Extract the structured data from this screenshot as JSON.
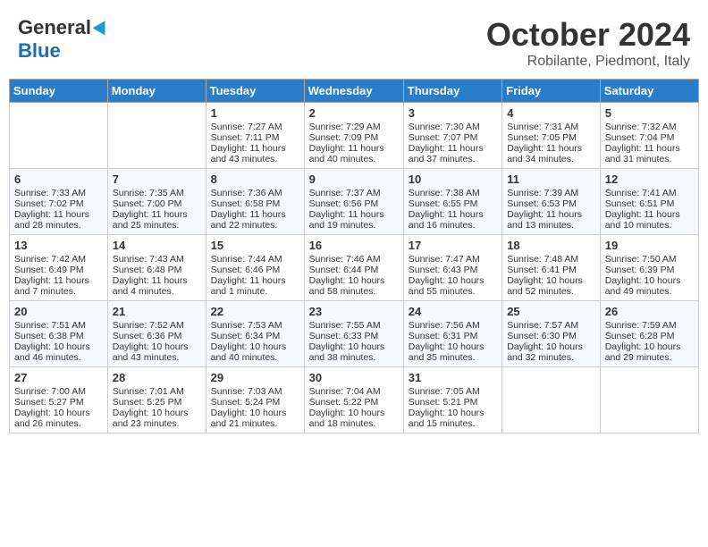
{
  "logo": {
    "general": "General",
    "blue": "Blue"
  },
  "title": "October 2024",
  "location": "Robilante, Piedmont, Italy",
  "days_of_week": [
    "Sunday",
    "Monday",
    "Tuesday",
    "Wednesday",
    "Thursday",
    "Friday",
    "Saturday"
  ],
  "weeks": [
    [
      {
        "day": "",
        "content": ""
      },
      {
        "day": "",
        "content": ""
      },
      {
        "day": "1",
        "content": "Sunrise: 7:27 AM\nSunset: 7:11 PM\nDaylight: 11 hours and 43 minutes."
      },
      {
        "day": "2",
        "content": "Sunrise: 7:29 AM\nSunset: 7:09 PM\nDaylight: 11 hours and 40 minutes."
      },
      {
        "day": "3",
        "content": "Sunrise: 7:30 AM\nSunset: 7:07 PM\nDaylight: 11 hours and 37 minutes."
      },
      {
        "day": "4",
        "content": "Sunrise: 7:31 AM\nSunset: 7:05 PM\nDaylight: 11 hours and 34 minutes."
      },
      {
        "day": "5",
        "content": "Sunrise: 7:32 AM\nSunset: 7:04 PM\nDaylight: 11 hours and 31 minutes."
      }
    ],
    [
      {
        "day": "6",
        "content": "Sunrise: 7:33 AM\nSunset: 7:02 PM\nDaylight: 11 hours and 28 minutes."
      },
      {
        "day": "7",
        "content": "Sunrise: 7:35 AM\nSunset: 7:00 PM\nDaylight: 11 hours and 25 minutes."
      },
      {
        "day": "8",
        "content": "Sunrise: 7:36 AM\nSunset: 6:58 PM\nDaylight: 11 hours and 22 minutes."
      },
      {
        "day": "9",
        "content": "Sunrise: 7:37 AM\nSunset: 6:56 PM\nDaylight: 11 hours and 19 minutes."
      },
      {
        "day": "10",
        "content": "Sunrise: 7:38 AM\nSunset: 6:55 PM\nDaylight: 11 hours and 16 minutes."
      },
      {
        "day": "11",
        "content": "Sunrise: 7:39 AM\nSunset: 6:53 PM\nDaylight: 11 hours and 13 minutes."
      },
      {
        "day": "12",
        "content": "Sunrise: 7:41 AM\nSunset: 6:51 PM\nDaylight: 11 hours and 10 minutes."
      }
    ],
    [
      {
        "day": "13",
        "content": "Sunrise: 7:42 AM\nSunset: 6:49 PM\nDaylight: 11 hours and 7 minutes."
      },
      {
        "day": "14",
        "content": "Sunrise: 7:43 AM\nSunset: 6:48 PM\nDaylight: 11 hours and 4 minutes."
      },
      {
        "day": "15",
        "content": "Sunrise: 7:44 AM\nSunset: 6:46 PM\nDaylight: 11 hours and 1 minute."
      },
      {
        "day": "16",
        "content": "Sunrise: 7:46 AM\nSunset: 6:44 PM\nDaylight: 10 hours and 58 minutes."
      },
      {
        "day": "17",
        "content": "Sunrise: 7:47 AM\nSunset: 6:43 PM\nDaylight: 10 hours and 55 minutes."
      },
      {
        "day": "18",
        "content": "Sunrise: 7:48 AM\nSunset: 6:41 PM\nDaylight: 10 hours and 52 minutes."
      },
      {
        "day": "19",
        "content": "Sunrise: 7:50 AM\nSunset: 6:39 PM\nDaylight: 10 hours and 49 minutes."
      }
    ],
    [
      {
        "day": "20",
        "content": "Sunrise: 7:51 AM\nSunset: 6:38 PM\nDaylight: 10 hours and 46 minutes."
      },
      {
        "day": "21",
        "content": "Sunrise: 7:52 AM\nSunset: 6:36 PM\nDaylight: 10 hours and 43 minutes."
      },
      {
        "day": "22",
        "content": "Sunrise: 7:53 AM\nSunset: 6:34 PM\nDaylight: 10 hours and 40 minutes."
      },
      {
        "day": "23",
        "content": "Sunrise: 7:55 AM\nSunset: 6:33 PM\nDaylight: 10 hours and 38 minutes."
      },
      {
        "day": "24",
        "content": "Sunrise: 7:56 AM\nSunset: 6:31 PM\nDaylight: 10 hours and 35 minutes."
      },
      {
        "day": "25",
        "content": "Sunrise: 7:57 AM\nSunset: 6:30 PM\nDaylight: 10 hours and 32 minutes."
      },
      {
        "day": "26",
        "content": "Sunrise: 7:59 AM\nSunset: 6:28 PM\nDaylight: 10 hours and 29 minutes."
      }
    ],
    [
      {
        "day": "27",
        "content": "Sunrise: 7:00 AM\nSunset: 5:27 PM\nDaylight: 10 hours and 26 minutes."
      },
      {
        "day": "28",
        "content": "Sunrise: 7:01 AM\nSunset: 5:25 PM\nDaylight: 10 hours and 23 minutes."
      },
      {
        "day": "29",
        "content": "Sunrise: 7:03 AM\nSunset: 5:24 PM\nDaylight: 10 hours and 21 minutes."
      },
      {
        "day": "30",
        "content": "Sunrise: 7:04 AM\nSunset: 5:22 PM\nDaylight: 10 hours and 18 minutes."
      },
      {
        "day": "31",
        "content": "Sunrise: 7:05 AM\nSunset: 5:21 PM\nDaylight: 10 hours and 15 minutes."
      },
      {
        "day": "",
        "content": ""
      },
      {
        "day": "",
        "content": ""
      }
    ]
  ]
}
